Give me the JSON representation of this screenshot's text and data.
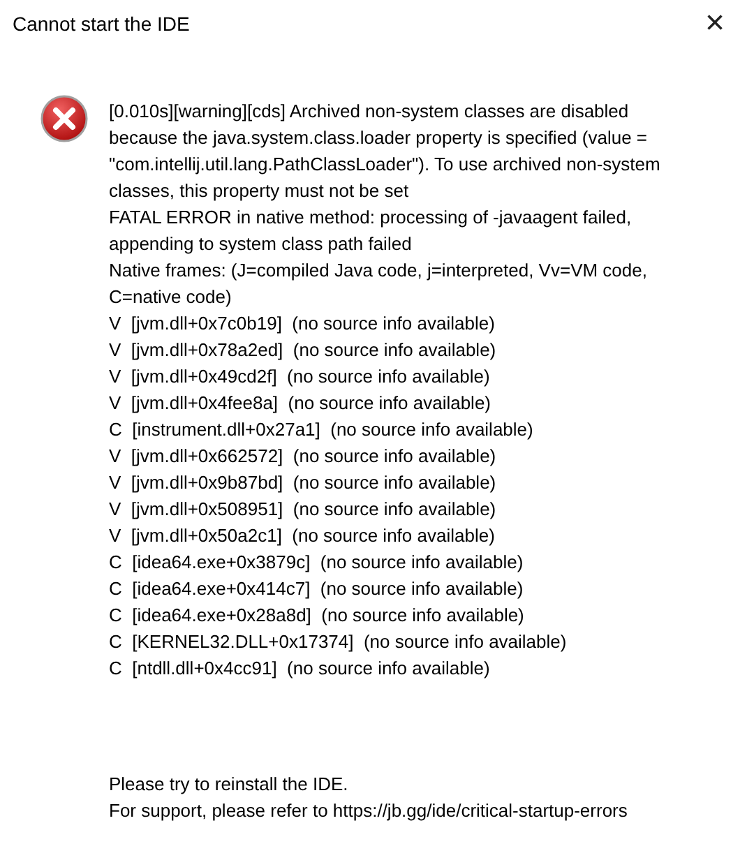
{
  "window": {
    "title": "Cannot start the IDE",
    "close": "×"
  },
  "message_lines": [
    "[0.010s][warning][cds] Archived non-system classes are disabled",
    "because the java.system.class.loader property is specified (value =",
    "\"com.intellij.util.lang.PathClassLoader\"). To use archived non-system",
    "classes, this property must not be set",
    "FATAL ERROR in native method: processing of -javaagent failed,",
    "appending to system class path failed",
    "Native frames: (J=compiled Java code, j=interpreted, Vv=VM code,",
    "C=native code)",
    "V  [jvm.dll+0x7c0b19]  (no source info available)",
    "V  [jvm.dll+0x78a2ed]  (no source info available)",
    "V  [jvm.dll+0x49cd2f]  (no source info available)",
    "V  [jvm.dll+0x4fee8a]  (no source info available)",
    "C  [instrument.dll+0x27a1]  (no source info available)",
    "V  [jvm.dll+0x662572]  (no source info available)",
    "V  [jvm.dll+0x9b87bd]  (no source info available)",
    "V  [jvm.dll+0x508951]  (no source info available)",
    "V  [jvm.dll+0x50a2c1]  (no source info available)",
    "C  [idea64.exe+0x3879c]  (no source info available)",
    "C  [idea64.exe+0x414c7]  (no source info available)",
    "C  [idea64.exe+0x28a8d]  (no source info available)",
    "C  [KERNEL32.DLL+0x17374]  (no source info available)",
    "C  [ntdll.dll+0x4cc91]  (no source info available)"
  ],
  "footer_lines": [
    "Please try to reinstall the IDE.",
    "For support, please refer to https://jb.gg/ide/critical-startup-errors"
  ]
}
